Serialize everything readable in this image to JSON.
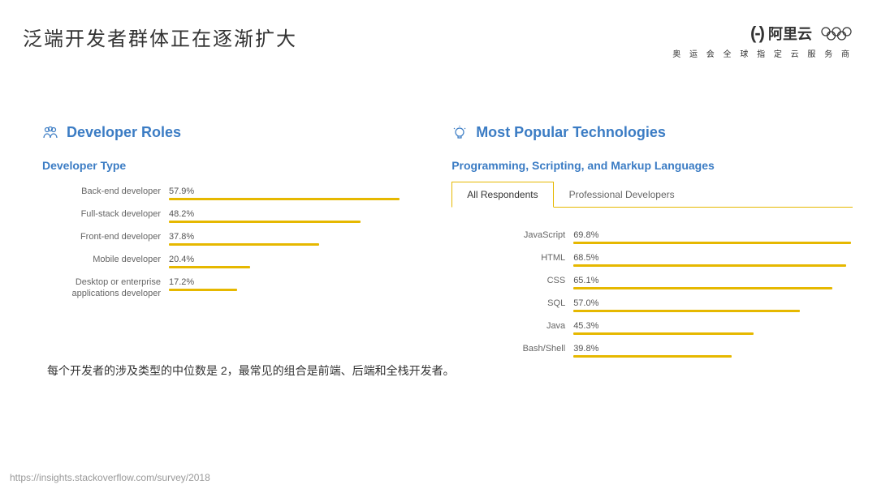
{
  "title": "泛端开发者群体正在逐渐扩大",
  "logo_text": "阿里云",
  "logo_subtitle": "奥 运 会 全 球 指 定 云 服 务 商",
  "left": {
    "section_title": "Developer Roles",
    "subtitle": "Developer Type"
  },
  "right": {
    "section_title": "Most Popular Technologies",
    "subtitle": "Programming, Scripting, and Markup Languages",
    "tabs": [
      "All Respondents",
      "Professional Developers"
    ]
  },
  "note": "每个开发者的涉及类型的中位数是 2，最常见的组合是前端、后端和全栈开发者。",
  "source": "https://insights.stackoverflow.com/survey/2018",
  "chart_data": [
    {
      "type": "bar",
      "title": "Developer Type",
      "orientation": "horizontal",
      "xlabel": "",
      "ylabel": "",
      "xlim": [
        0,
        100
      ],
      "categories": [
        "Back-end developer",
        "Full-stack developer",
        "Front-end developer",
        "Mobile developer",
        "Desktop or enterprise applications developer"
      ],
      "values": [
        57.9,
        48.2,
        37.8,
        20.4,
        17.2
      ],
      "bar_scale": 4.9
    },
    {
      "type": "bar",
      "title": "Programming, Scripting, and Markup Languages — All Respondents",
      "orientation": "horizontal",
      "xlabel": "",
      "ylabel": "",
      "xlim": [
        0,
        100
      ],
      "categories": [
        "JavaScript",
        "HTML",
        "CSS",
        "SQL",
        "Java",
        "Bash/Shell"
      ],
      "values": [
        69.8,
        68.5,
        65.1,
        57.0,
        45.3,
        39.8
      ],
      "bar_scale": 4.9
    }
  ]
}
